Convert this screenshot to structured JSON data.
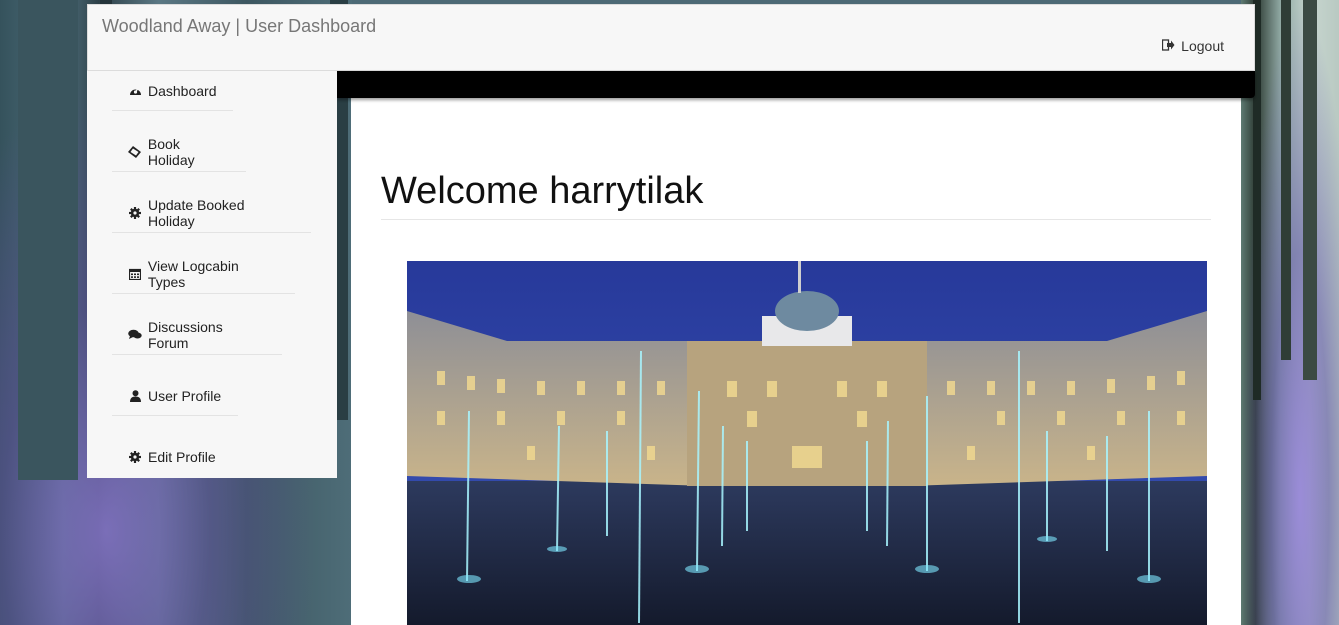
{
  "app": {
    "brand": "Woodland Away | User Dashboard"
  },
  "navbar": {
    "logout_label": "Logout",
    "logout_icon": "sign-out-icon"
  },
  "sidebar": {
    "items": [
      {
        "label": "Dashboard",
        "icon": "dashboard-icon"
      },
      {
        "label": "Book Holiday",
        "icon": "ticket-icon"
      },
      {
        "label": "Update Booked Holiday",
        "icon": "gear-icon"
      },
      {
        "label": "View Logcabin Types",
        "icon": "calendar-icon"
      },
      {
        "label": "Discussions Forum",
        "icon": "comments-icon"
      },
      {
        "label": "User Profile",
        "icon": "user-icon"
      },
      {
        "label": "Edit Profile",
        "icon": "gear-icon"
      }
    ]
  },
  "main": {
    "title": "Welcome harrytilak"
  },
  "colors": {
    "navbar_bg": "#f7f7f7",
    "accent_bar": "#000000",
    "content_bg": "#ffffff"
  }
}
